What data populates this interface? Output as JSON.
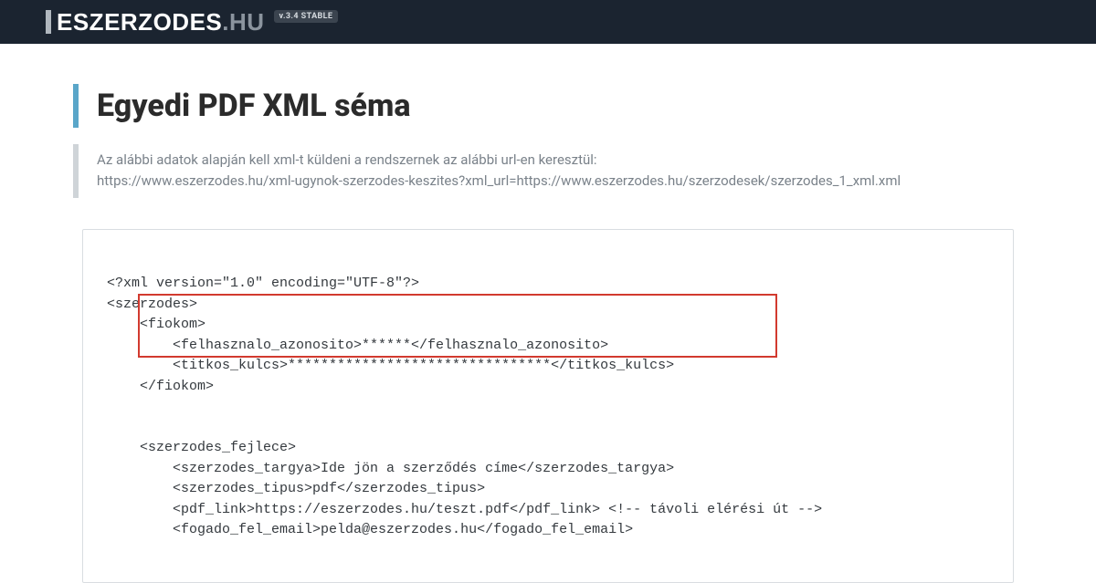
{
  "brand": {
    "name_main": "ESZERZODES",
    "name_tld": ".HU",
    "version_badge": "v.3.4 STABLE"
  },
  "page": {
    "title": "Egyedi PDF XML séma",
    "desc_line1": "Az alábbi adatok alapján kell xml-t küldeni a rendszernek az alábbi url-en keresztül:",
    "desc_line2": "https://www.eszerzodes.hu/xml-ugynok-szerzodes-keszites?xml_url=https://www.eszerzodes.hu/szerzodesek/szerzodes_1_xml.xml"
  },
  "code_lines": {
    "l1": "<?xml version=\"1.0\" encoding=\"UTF-8\"?>",
    "l2": "<szerzodes>",
    "l3": "    <fiokom>",
    "l4": "        <felhasznalo_azonosito>******</felhasznalo_azonosito>",
    "l5": "        <titkos_kulcs>********************************</titkos_kulcs>",
    "l6": "    </fiokom>",
    "l7": "",
    "l8": "    <szerzodes_fejlece>",
    "l9": "        <szerzodes_targya>Ide jön a szerződés címe</szerzodes_targya>",
    "l10": "        <szerzodes_tipus>pdf</szerzodes_tipus>",
    "l11": "        <pdf_link>https://eszerzodes.hu/teszt.pdf</pdf_link> <!-- távoli elérési út -->",
    "l12": "        <fogado_fel_email>pelda@eszerzodes.hu</fogado_fel_email>"
  }
}
